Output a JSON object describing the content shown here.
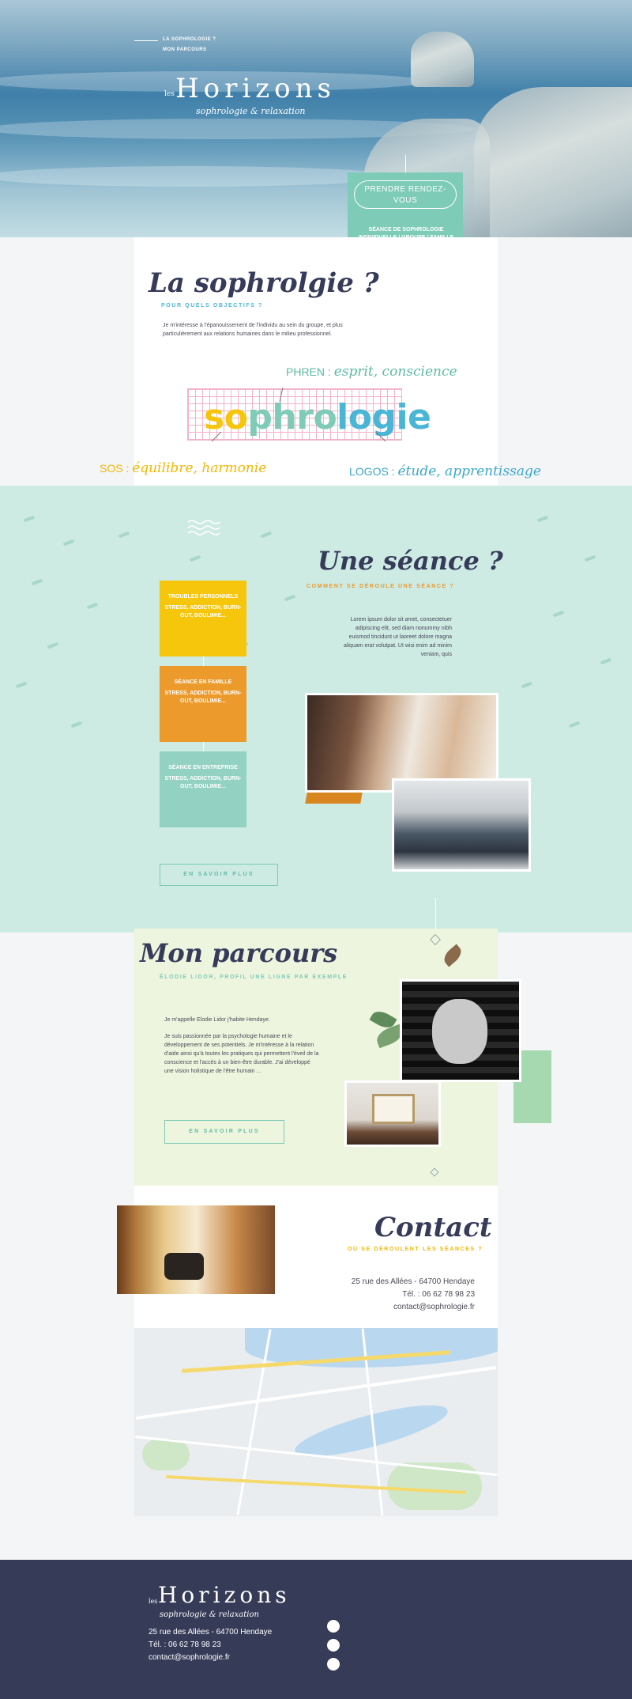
{
  "hero": {
    "nav": [
      "LA SOPHROLOGIE ?",
      "MON PARCOURS"
    ],
    "logo": {
      "les": "les",
      "name": "Horizons",
      "tagline": "sophrologie & relaxation"
    },
    "cta_label": "PRENDRE RENDEZ-VOUS",
    "cta_caption_1": "SÉANCE DE SOPHROLOGIE",
    "cta_caption_2": "INDIVIDUELLE / GROUPE / FAMILLE"
  },
  "sophro": {
    "title": "La sophrolgie ?",
    "kicker": "POUR QUELS OBJECTIFS ?",
    "intro": "Je m'intéresse à l'épanouissement de l'individu au sein du groupe, et plus particulièrement aux relations humaines dans le milieu professionnel.",
    "word_so": "so",
    "word_phro": "phro",
    "word_logie": "logie",
    "phren_key": "PHREN : ",
    "phren_val": "esprit, conscience",
    "sos_key": "SOS : ",
    "sos_val": "équilibre, harmonie",
    "logos_key": "LOGOS : ",
    "logos_val": "étude, apprentissage"
  },
  "seance": {
    "title": "Une séance ?",
    "kicker": "COMMENT SE DÉROULE UNE SÉANCE ?",
    "text": "Lorem ipsum dolor sit amet, consectetuer adipiscing elit, sed diam nonummy nibh euismod tincidunt ut laoreet dolore magna aliquam erat volutpat. Ut wisi enim ad minim veniam, quis",
    "boxes": [
      {
        "title": "TROUBLES PERSONNELS",
        "items": "STRESS, ADDICTION, BURN-OUT, BOULIMIE..."
      },
      {
        "title": "SÉANCE EN FAMILLE",
        "items": "STRESS, ADDICTION, BURN-OUT, BOULIMIE..."
      },
      {
        "title": "SÉANCE EN ENTREPRISE",
        "items": "STRESS, ADDICTION, BURN-OUT, BOULIMIE..."
      }
    ],
    "more": "EN SAVOIR PLUS"
  },
  "parcours": {
    "title": "Mon parcours",
    "kicker": "ÉLODIE LIDOR, PROFIL UNE LIGNE PAR EXEMPLE",
    "p1": "Je m'appelle Elodie Lidor j'habite Hendaye.",
    "p2": "Je suis passionnée par la psychologie humaine et le développement de ses potentiels. Je m'intéresse à la relation d'aide ainsi qu'à toutes les pratiques qui permettent l'éveil de la conscience et l'accès à un bien-être durable. J'ai développé une vision holistique de l'être humain ...",
    "more": "EN SAVOIR PLUS"
  },
  "contact": {
    "title": "Contact",
    "kicker": "OÙ SE DÉROULENT LES SÉANCES ?",
    "address": "25 rue des Allées - 64700 Hendaye",
    "phone": "Tél. : 06 62 78 98 23",
    "email": "contact@sophrologie.fr"
  },
  "footer": {
    "logo": {
      "les": "les",
      "name": "Horizons",
      "tagline": "sophrologie & relaxation"
    },
    "address": "25 rue des Allées - 64700 Hendaye",
    "phone": "Tél. : 06 62 78 98 23",
    "email": "contact@sophrologie.fr"
  },
  "colors": {
    "navy": "#363b5a",
    "teal": "#7ecbb7",
    "yellow": "#f6c60d",
    "orange": "#ec9a2c",
    "mint_bg": "#cdeae3",
    "lime_bg": "#eef5df"
  }
}
